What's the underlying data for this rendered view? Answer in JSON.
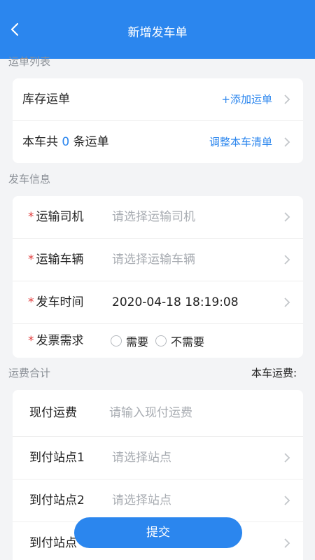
{
  "header": {
    "title": "新增发车单"
  },
  "waybill_section": {
    "label": "运单列表",
    "stock_label": "库存运单",
    "add_action": "+添加运单",
    "count_prefix": "本车共",
    "count": "0",
    "count_suffix": "条运单",
    "adjust_action": "调整本车清单"
  },
  "dispatch_section": {
    "label": "发车信息",
    "required_mark": "*",
    "driver_label": "运输司机",
    "driver_placeholder": "请选择运输司机",
    "vehicle_label": "运输车辆",
    "vehicle_placeholder": "请选择运输车辆",
    "time_label": "发车时间",
    "time_value": "2020-04-18 18:19:08",
    "invoice_label": "发票需求",
    "invoice_options": [
      "需要",
      "不需要"
    ]
  },
  "fee_section": {
    "label": "运费合计",
    "total_label": "本车运费:",
    "cash_label": "现付运费",
    "cash_placeholder": "请输入现付运费",
    "station1_label": "到付站点1",
    "station2_label": "到付站点2",
    "station3_label": "到付站点",
    "station_placeholder": "请选择站点"
  },
  "submit_label": "提交",
  "colors": {
    "accent": "#2b86ee",
    "required": "#e03a3a"
  },
  "icons": {
    "back": "back-arrow-icon",
    "chevron": "chevron-right-icon"
  }
}
